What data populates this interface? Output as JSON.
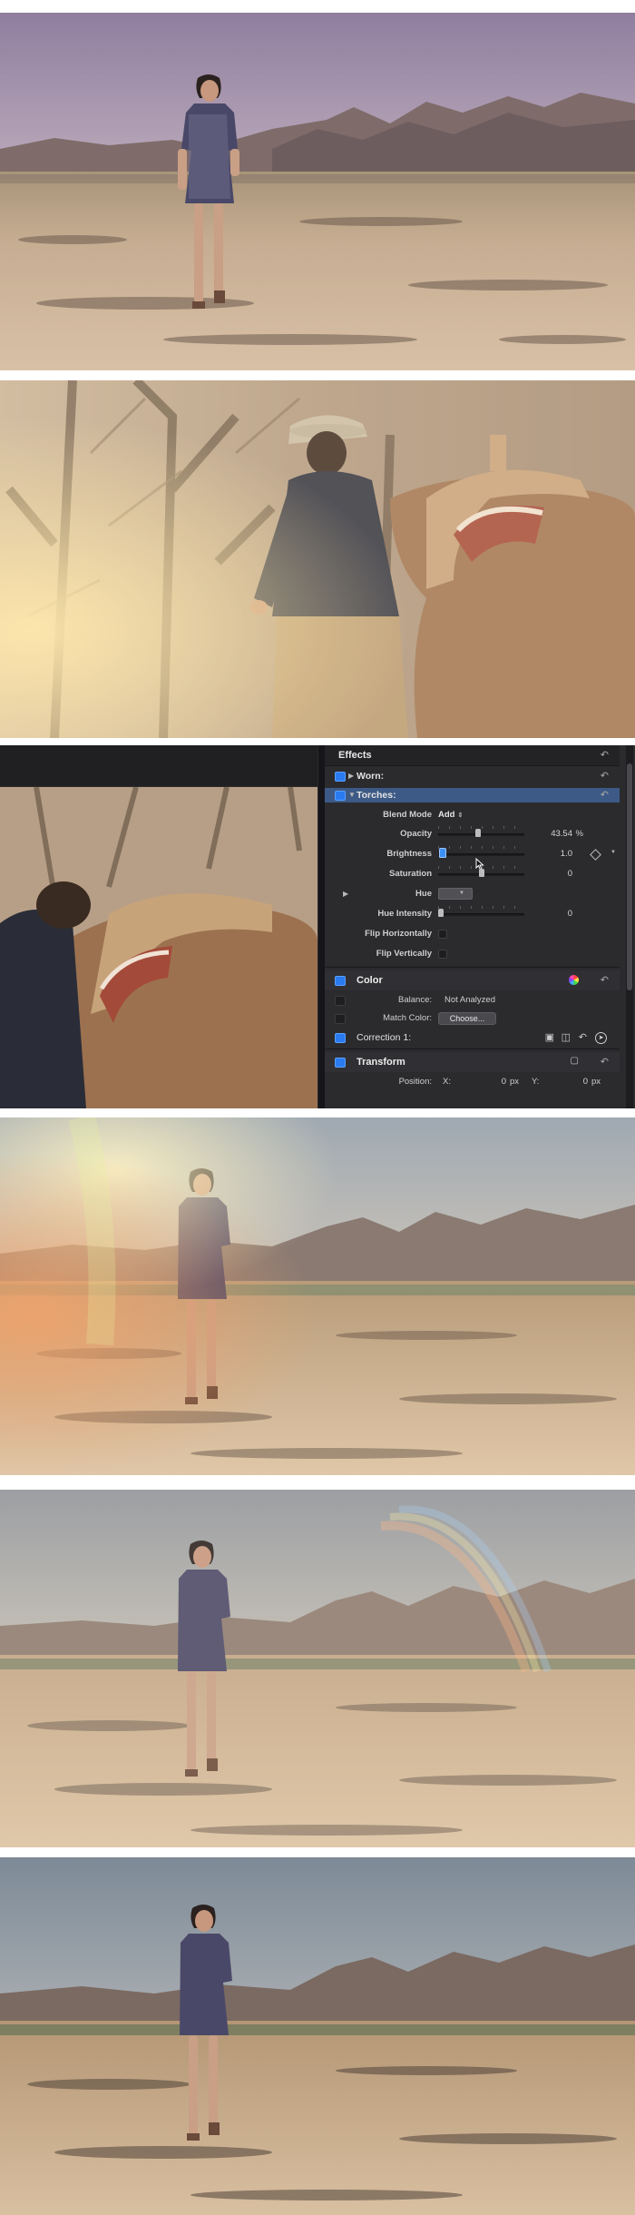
{
  "inspector": {
    "title": "Effects",
    "effects": [
      {
        "name": "Worn:"
      },
      {
        "name": "Torches:"
      }
    ],
    "params": {
      "blend_mode": {
        "label": "Blend Mode",
        "value": "Add"
      },
      "opacity": {
        "label": "Opacity",
        "value": "43.54",
        "unit": "%",
        "level": 0.4354
      },
      "brightness": {
        "label": "Brightness",
        "value": "1.0",
        "level": 0.05
      },
      "saturation": {
        "label": "Saturation",
        "value": "0",
        "level": 0.5
      },
      "hue": {
        "label": "Hue"
      },
      "hue_intensity": {
        "label": "Hue Intensity",
        "value": "0",
        "level": 0.0
      },
      "flip_h": {
        "label": "Flip Horizontally"
      },
      "flip_v": {
        "label": "Flip Vertically"
      }
    },
    "color": {
      "title": "Color",
      "balance_label": "Balance:",
      "balance_value": "Not Analyzed",
      "match_label": "Match Color:",
      "choose_label": "Choose..."
    },
    "correction": {
      "title": "Correction 1:"
    },
    "transform": {
      "title": "Transform",
      "position_label": "Position:",
      "x_label": "X:",
      "x_value": "0",
      "x_unit": "px",
      "y_label": "Y:",
      "y_value": "0",
      "y_unit": "px"
    }
  },
  "icons": [
    "reset-icon",
    "disclosure-triangle-icon",
    "keyframe-diamond-icon",
    "color-wheel-icon",
    "pointer-cursor-icon",
    "circle-arrow-icon",
    "onscreen-controls-icon"
  ],
  "colors": {
    "selection": "#3d5a86",
    "checkbox_on": "#2a7af0",
    "panel": "#2b2b2e"
  }
}
